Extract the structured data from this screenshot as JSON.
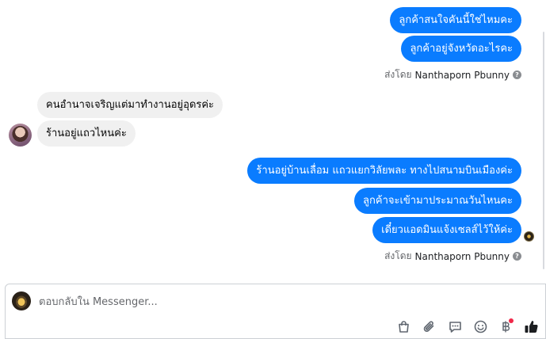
{
  "messages": [
    {
      "direction": "out",
      "text": "ลูกค้าสนใจคันนี้ใช่ไหมคะ"
    },
    {
      "direction": "out",
      "text": "ลูกค้าอยู่จังหวัดอะไรคะ"
    },
    {
      "direction": "meta",
      "prefix": "ส่งโดย",
      "sender": "Nanthaporn Pbunny"
    },
    {
      "direction": "in",
      "text": "คนอำนาจเจริญแต่มาทำงานอยู่อุดรค่ะ"
    },
    {
      "direction": "in",
      "text": "ร้านอยู่แถวไหนค่ะ"
    },
    {
      "direction": "out",
      "text": "ร้านอยู่บ้านเลื่อม แถวแยกวิลัยพละ ทางไปสนามบินเมืองค่ะ"
    },
    {
      "direction": "out",
      "text": "ลูกค้าจะเข้ามาประมาณวันไหนคะ"
    },
    {
      "direction": "out",
      "text": "เดี๋ยวแอดมินแจ้งเซลส์ไว้ให้ค่ะ"
    },
    {
      "direction": "meta",
      "prefix": "ส่งโดย",
      "sender": "Nanthaporn Pbunny"
    }
  ],
  "sent_by_1": {
    "prefix": "ส่งโดย",
    "sender": "Nanthaporn Pbunny"
  },
  "sent_by_2": {
    "prefix": "ส่งโดย",
    "sender": "Nanthaporn Pbunny"
  },
  "composer": {
    "placeholder": "ตอบกลับใน Messenger...",
    "value": ""
  },
  "toolbar_icons": [
    "shopping-bag-icon",
    "paperclip-icon",
    "saved-reply-icon",
    "emoji-icon",
    "baht-payment-icon",
    "like-icon"
  ],
  "colors": {
    "outgoing": "#0a7cff",
    "incoming": "#f0f0f0",
    "badge": "#f02849",
    "like": "#1c1e21"
  }
}
